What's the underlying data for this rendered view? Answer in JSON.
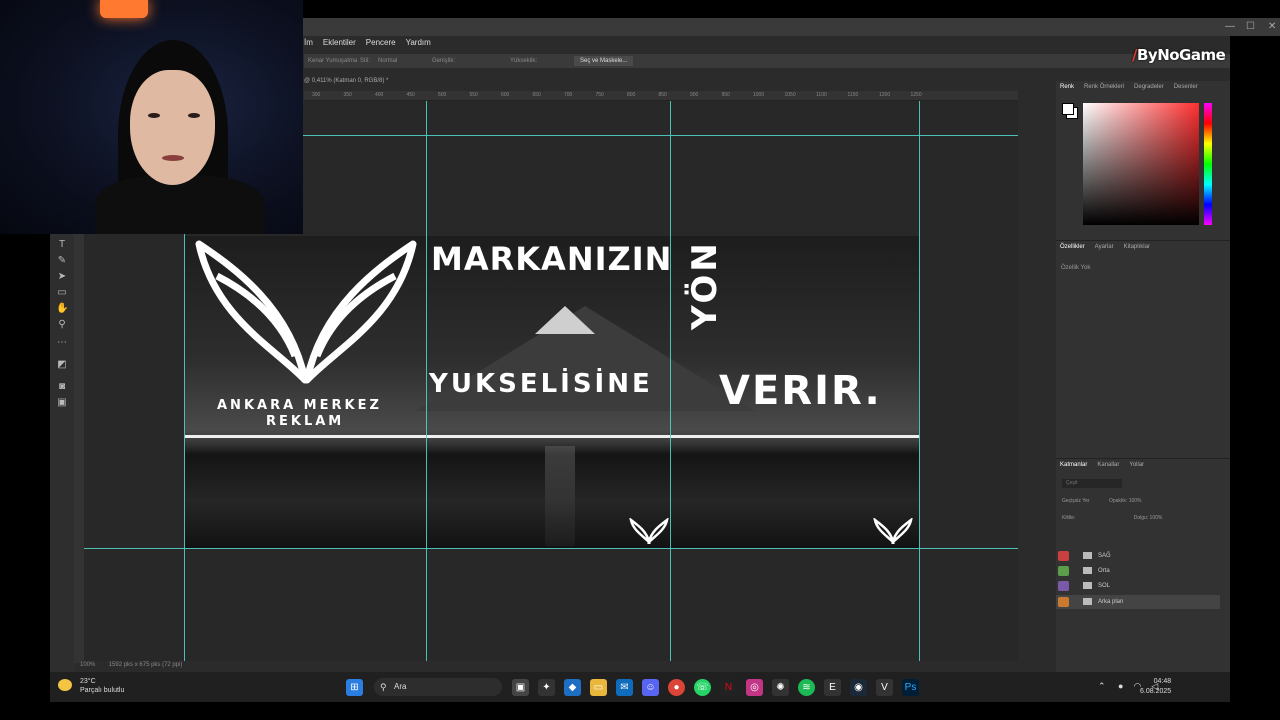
{
  "window": {
    "controls": [
      "—",
      "☐",
      "✕"
    ]
  },
  "menu": [
    "İm",
    "Eklentiler",
    "Pencere",
    "Yardım"
  ],
  "options_bar": {
    "items": [
      "Kenar Yumuşatma",
      "Stil:",
      "Normal",
      "Genişlik:",
      "Yükseklik:"
    ],
    "select_mask": "Seç ve Maskele..."
  },
  "doc_tab": "@ 0,411% (Katman 0, RGB/8) *",
  "ruler_marks": [
    "300",
    "350",
    "400",
    "450",
    "500",
    "550",
    "600",
    "650",
    "700",
    "750",
    "800",
    "850",
    "900",
    "950",
    "1000",
    "1050",
    "1100",
    "1150",
    "1200",
    "1250"
  ],
  "artboard": {
    "brand_line1": "ANKARA MERKEZ",
    "brand_line2": "REKLAM",
    "headline_1": "MARKANIZIN",
    "headline_2": "YUKSELİSİNE",
    "headline_vertical": "YÖN",
    "headline_3": "VERIR."
  },
  "status": {
    "zoom": "100%",
    "doc_size": "1592 pks x 675 pks (72 ppi)"
  },
  "color_panel": {
    "tabs": [
      "Renk",
      "Renk Örnekleri",
      "Degradeler",
      "Desenler"
    ]
  },
  "properties_panel": {
    "tabs": [
      "Özellikler",
      "Ayarlar",
      "Kitaplıklar"
    ],
    "empty_text": "Özellik Yok"
  },
  "layers_panel": {
    "tabs": [
      "Katmanlar",
      "Kanallar",
      "Yollar"
    ],
    "search": "Çeşit",
    "blend_mode": "Geçişsiz Yer",
    "opacity_label": "Opaklık:",
    "opacity": "100%",
    "lock_label": "Kilitle:",
    "fill_label": "Dolgu:",
    "fill": "100%",
    "layers": [
      {
        "name": "SAĞ",
        "color": "#c94040"
      },
      {
        "name": "Orta",
        "color": "#5a9e4a"
      },
      {
        "name": "SOL",
        "color": "#7a5aa8"
      },
      {
        "name": "Arka plan",
        "color": "#c97a30"
      }
    ]
  },
  "overlay": {
    "channel_logo": "ByNoGame"
  },
  "taskbar": {
    "weather_temp": "23°C",
    "weather_desc": "Parçalı bulutlu",
    "search_placeholder": "Ara",
    "time": "04:48",
    "date": "6.08.2025"
  }
}
